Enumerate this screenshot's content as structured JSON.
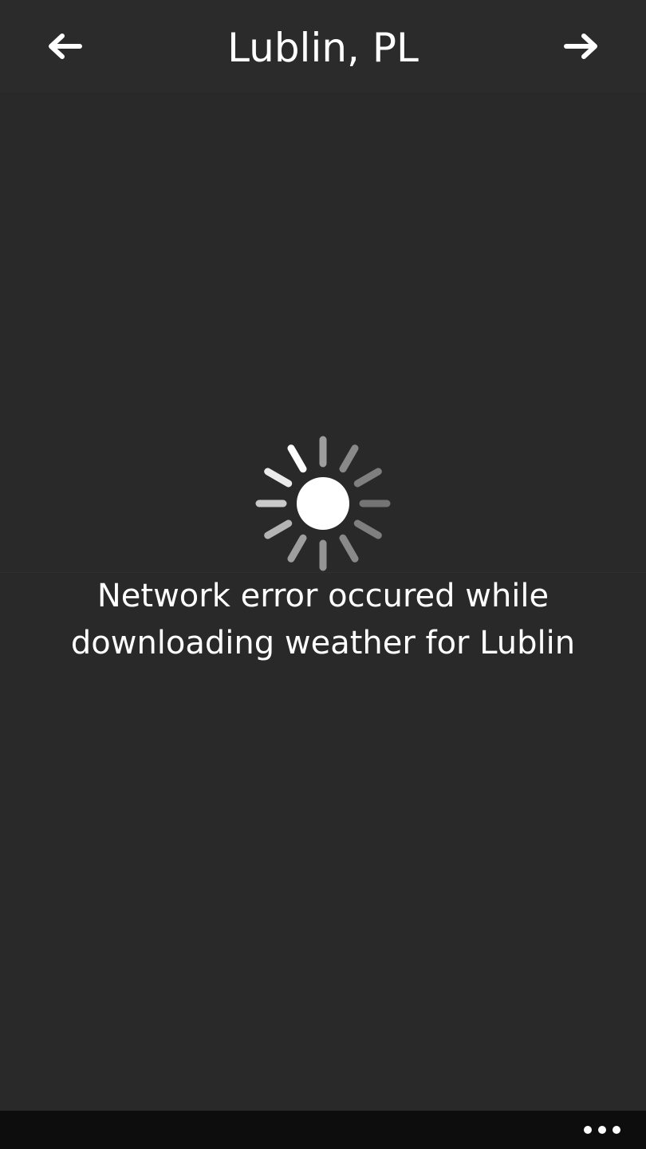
{
  "header": {
    "title": "Lublin, PL",
    "prev_icon": "arrow-left-icon",
    "next_icon": "arrow-right-icon"
  },
  "main": {
    "status_icon": "loading-sun-icon",
    "error_message": "Network error occured while downloading weather for Lublin"
  },
  "appbar": {
    "more_icon": "ellipsis-icon"
  },
  "colors": {
    "background": "#292929",
    "appbar": "#0d0d0d",
    "foreground": "#ffffff"
  }
}
